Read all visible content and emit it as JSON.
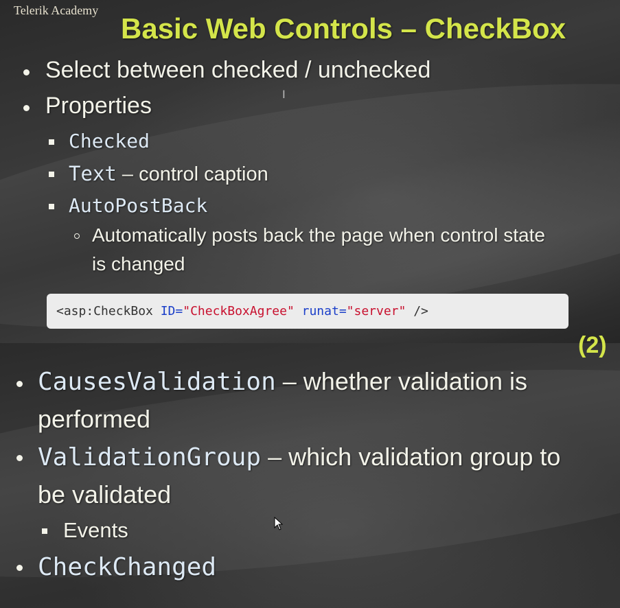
{
  "slide1": {
    "logo": "Telerik Academy",
    "title": "Basic Web Controls – CheckBox",
    "bullets": [
      "Select between checked / unchecked",
      "Properties"
    ],
    "sub": [
      {
        "code": "Checked",
        "text": ""
      },
      {
        "code": "Text",
        "text": " – control caption"
      },
      {
        "code": "AutoPostBack",
        "text": ""
      }
    ],
    "subsub": [
      "Automatically posts back the page when control state",
      "is changed"
    ],
    "code": {
      "tag": "<asp:CheckBox ",
      "attr1": "ID=",
      "val1": "\"CheckBoxAgree\"",
      "attr2": " runat=",
      "val2": "\"server\"",
      "end": " />"
    }
  },
  "slide2": {
    "title_fragment": "(2)",
    "items": [
      {
        "code": "CausesValidation",
        "text": " – whether validation is",
        "cont": "performed"
      },
      {
        "code": "ValidationGroup",
        "text": " – which validation group to",
        "cont": "be validated"
      }
    ],
    "sub": "Events",
    "last": "CheckChanged"
  },
  "colors": {
    "title": "#d4e54a",
    "text": "#f3f3e9",
    "code_attr": "#1a3ec9",
    "code_string": "#c8102e"
  }
}
